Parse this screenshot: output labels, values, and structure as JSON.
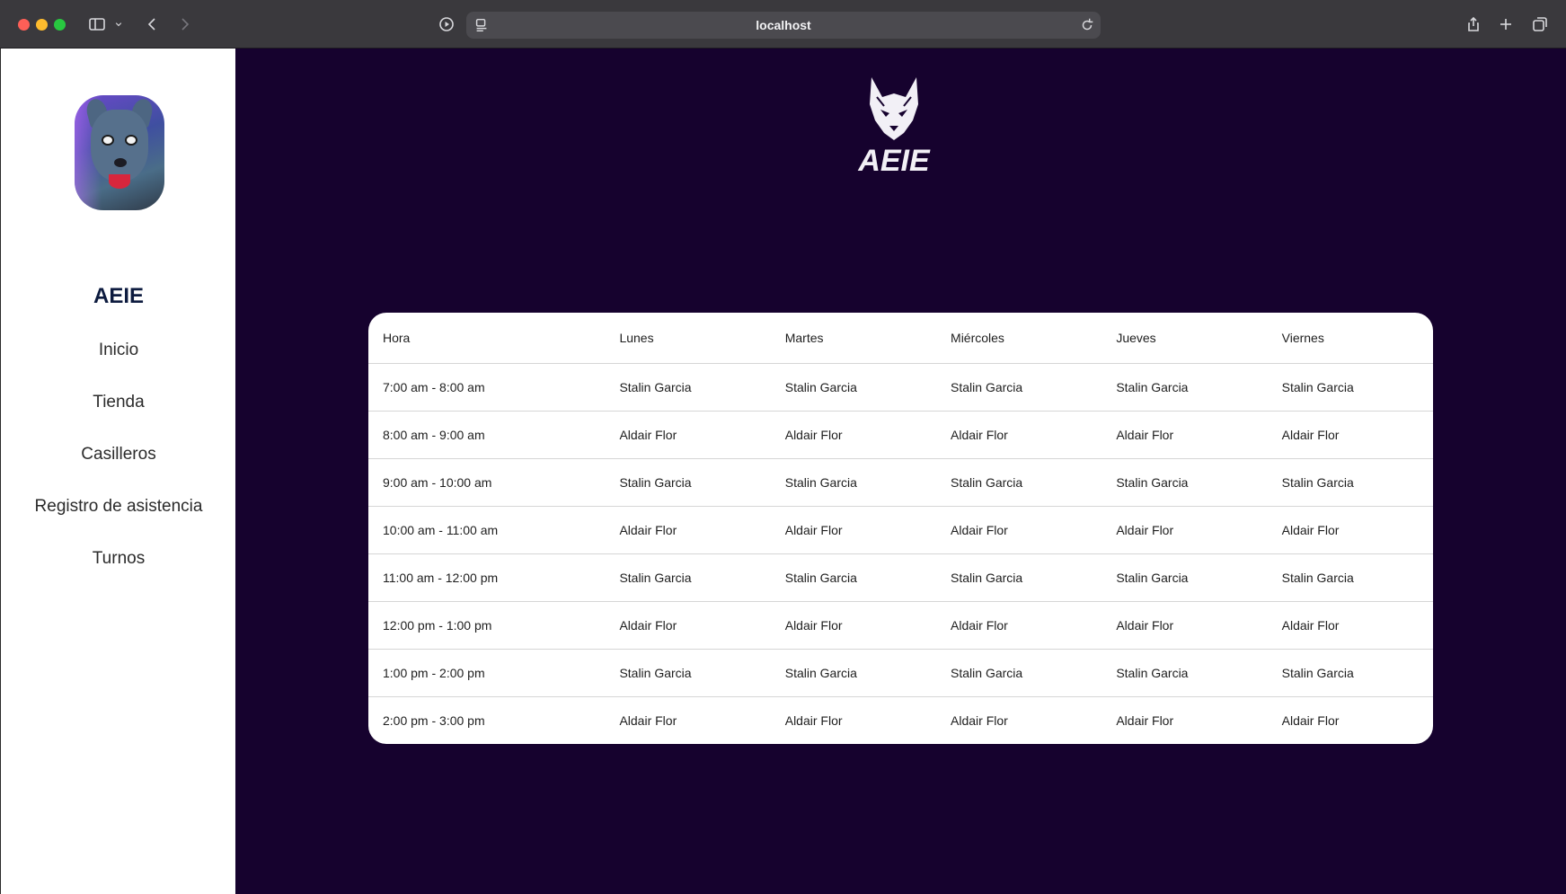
{
  "browser": {
    "url": "localhost"
  },
  "sidebar": {
    "brand": "AEIE",
    "nav": [
      "Inicio",
      "Tienda",
      "Casilleros",
      "Registro de asistencia",
      "Turnos"
    ]
  },
  "logo": {
    "text": "AEIE"
  },
  "schedule": {
    "headers": [
      "Hora",
      "Lunes",
      "Martes",
      "Miércoles",
      "Jueves",
      "Viernes"
    ],
    "rows": [
      [
        "7:00 am - 8:00 am",
        "Stalin Garcia",
        "Stalin Garcia",
        "Stalin Garcia",
        "Stalin Garcia",
        "Stalin Garcia"
      ],
      [
        "8:00 am - 9:00 am",
        "Aldair Flor",
        "Aldair Flor",
        "Aldair Flor",
        "Aldair Flor",
        "Aldair Flor"
      ],
      [
        "9:00 am - 10:00 am",
        "Stalin Garcia",
        "Stalin Garcia",
        "Stalin Garcia",
        "Stalin Garcia",
        "Stalin Garcia"
      ],
      [
        "10:00 am - 11:00 am",
        "Aldair Flor",
        "Aldair Flor",
        "Aldair Flor",
        "Aldair Flor",
        "Aldair Flor"
      ],
      [
        "11:00 am - 12:00 pm",
        "Stalin Garcia",
        "Stalin Garcia",
        "Stalin Garcia",
        "Stalin Garcia",
        "Stalin Garcia"
      ],
      [
        "12:00 pm - 1:00 pm",
        "Aldair Flor",
        "Aldair Flor",
        "Aldair Flor",
        "Aldair Flor",
        "Aldair Flor"
      ],
      [
        "1:00 pm - 2:00 pm",
        "Stalin Garcia",
        "Stalin Garcia",
        "Stalin Garcia",
        "Stalin Garcia",
        "Stalin Garcia"
      ],
      [
        "2:00 pm - 3:00 pm",
        "Aldair Flor",
        "Aldair Flor",
        "Aldair Flor",
        "Aldair Flor",
        "Aldair Flor"
      ]
    ]
  },
  "colors": {
    "page_background": "#16022e",
    "sidebar_background": "#ffffff",
    "brand_text": "#0d1b3f"
  }
}
